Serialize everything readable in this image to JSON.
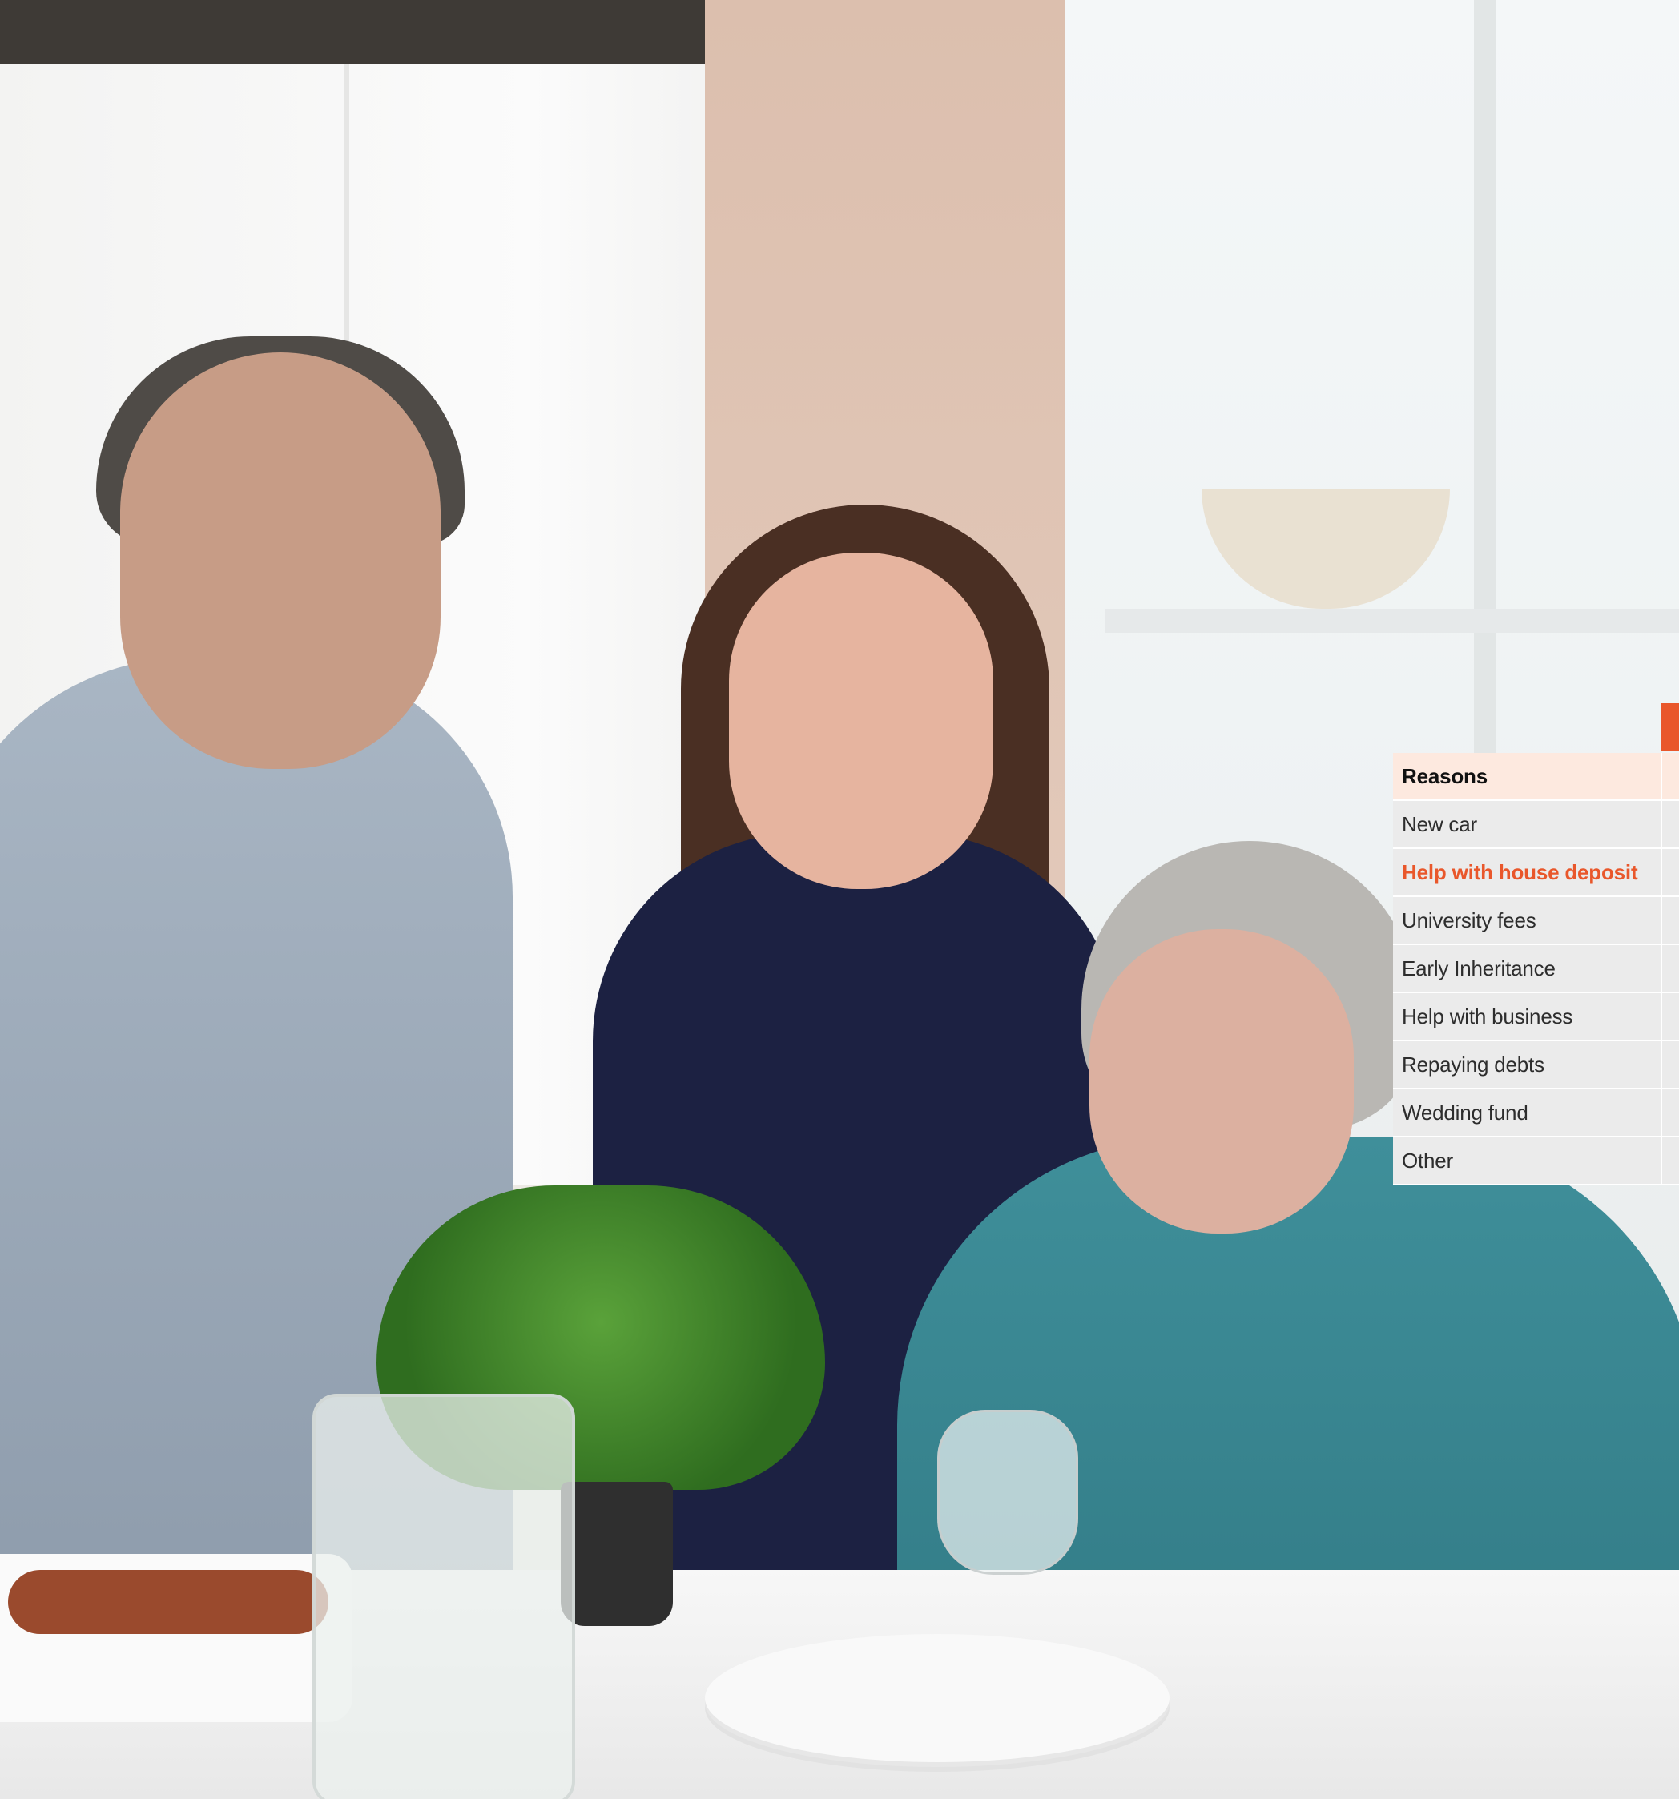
{
  "colors": {
    "accent": "#e9572b",
    "header_bg": "#fde9df",
    "row_bg": "#ebebeb"
  },
  "photo": {
    "subject": "family-kitchen-photo"
  },
  "table": {
    "header": "Reasons",
    "rows": [
      "New car",
      "Help with house deposit",
      "University fees",
      "Early Inheritance",
      "Help with business",
      "Repaying debts",
      "Wedding fund",
      "Other"
    ],
    "highlighted_row": "Help with house deposit"
  }
}
